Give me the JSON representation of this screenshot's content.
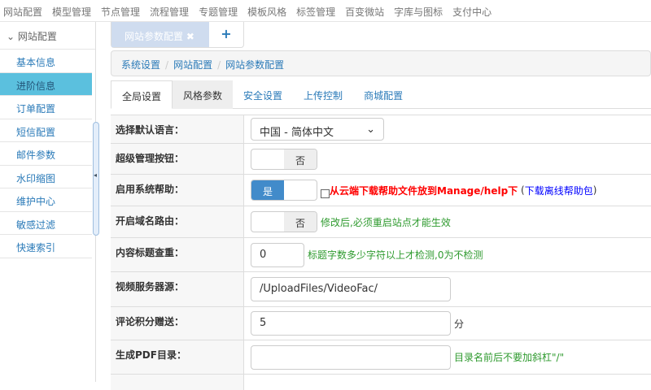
{
  "topnav": [
    "网站配置",
    "模型管理",
    "节点管理",
    "流程管理",
    "专题管理",
    "模板风格",
    "标签管理",
    "百变微站",
    "字库与图标",
    "支付中心"
  ],
  "sidebar": {
    "header": "网站配置",
    "items": [
      "基本信息",
      "进阶信息",
      "订单配置",
      "短信配置",
      "邮件参数",
      "水印缩图",
      "维护中心",
      "敏感过滤",
      "快速索引"
    ],
    "active": 1
  },
  "page_tabs": {
    "current": "网站参数配置",
    "close": "✖",
    "add": "+"
  },
  "breadcrumb": [
    "系统设置",
    "网站配置",
    "网站参数配置"
  ],
  "subtabs": [
    "全局设置",
    "风格参数",
    "安全设置",
    "上传控制",
    "商城配置"
  ],
  "form": {
    "language": {
      "label": "选择默认语言：",
      "value": "中国 - 简体中文"
    },
    "super_admin": {
      "label": "超级管理按钮：",
      "state": "否"
    },
    "help": {
      "label": "启用系统帮助：",
      "state": "是",
      "note": "从云端下载帮助文件放到Manage/help下",
      "link": "下载离线帮助包",
      "paren_open": "(",
      "paren_close": ")"
    },
    "domain_route": {
      "label": "开启域名路由：",
      "state": "否",
      "hint": "修改后,必须重启站点才能生效"
    },
    "title_check": {
      "label": "内容标题查重：",
      "value": "0",
      "hint": "标题字数多少字符以上才检测,0为不检测"
    },
    "video_server": {
      "label": "视频服务器源：",
      "value": "/UploadFiles/VideoFac/"
    },
    "comment_points": {
      "label": "评论积分赠送：",
      "value": "5",
      "unit": "分"
    },
    "pdf_dir": {
      "label": "生成PDF目录：",
      "value": "",
      "hint": "目录名前后不要加斜杠\"/\""
    }
  },
  "colors": {
    "accent": "#428bca",
    "active_sidebar": "#5bc0de",
    "hint": "#2e9a2e",
    "warning": "#ff0000"
  }
}
